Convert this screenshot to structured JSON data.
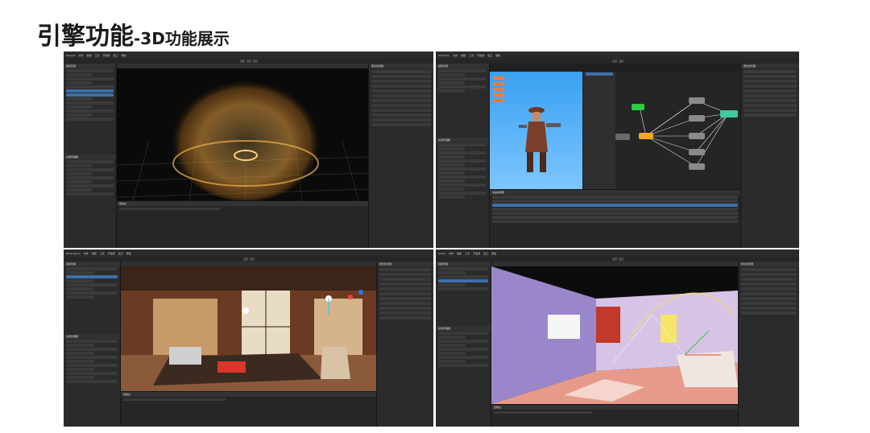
{
  "slide": {
    "title_main": "引擎功能",
    "title_sub": "-3D功能展示"
  },
  "screens": {
    "particle": {
      "window_title": "FantuiD",
      "menu": [
        "文件",
        "编辑",
        "工具",
        "开发者",
        "窗口",
        "帮助"
      ],
      "scene_tab": "层级管理",
      "inspector_tab": "属性检查器",
      "assets_tab": "资源管理器",
      "console_tab": "控制台"
    },
    "animation": {
      "window_title": "3D Demo",
      "menu": [
        "文件",
        "编辑",
        "工具",
        "开发者",
        "窗口",
        "帮助"
      ],
      "scene_tab": "层级管理",
      "inspector_tab": "属性检查器",
      "assets_tab": "资源管理器",
      "console_tab": "动画编辑器"
    },
    "office": {
      "window_title": "Work Space",
      "menu": [
        "文件",
        "编辑",
        "工具",
        "开发者",
        "窗口",
        "帮助"
      ],
      "scene_tab": "层级管理",
      "inspector_tab": "属性检查器",
      "assets_tab": "资源管理器",
      "console_tab": "控制台"
    },
    "room": {
      "window_title": "Scene",
      "menu": [
        "文件",
        "编辑",
        "工具",
        "开发者",
        "窗口",
        "帮助"
      ],
      "scene_tab": "层级管理",
      "inspector_tab": "属性检查器",
      "assets_tab": "资源管理器",
      "console_tab": "控制台"
    }
  }
}
